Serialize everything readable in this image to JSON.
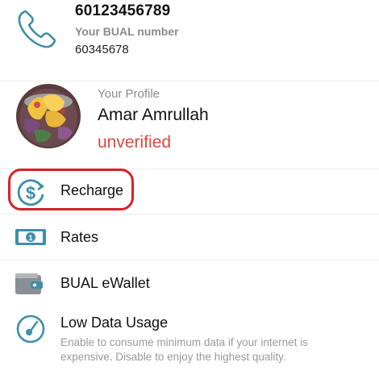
{
  "account": {
    "phone_number": "60123456789",
    "caption": "Your BUAL number",
    "secondary_number": "60345678"
  },
  "profile": {
    "caption": "Your Profile",
    "name": "Amar Amrullah",
    "status": "unverified",
    "status_color": "#e0463f"
  },
  "menu": {
    "recharge": {
      "label": "Recharge",
      "icon": "recharge-dollar-icon"
    },
    "rates": {
      "label": "Rates",
      "icon": "banknote-icon"
    },
    "ewallet": {
      "label": "BUAL eWallet",
      "icon": "wallet-icon"
    },
    "low_data": {
      "label": "Low Data Usage",
      "icon": "gauge-icon",
      "description": "Enable to consume minimum data if your internet is expensive. Disable to enjoy the highest quality."
    }
  },
  "highlight_color": "#d8202a",
  "icon_color": "#3e8fa8"
}
